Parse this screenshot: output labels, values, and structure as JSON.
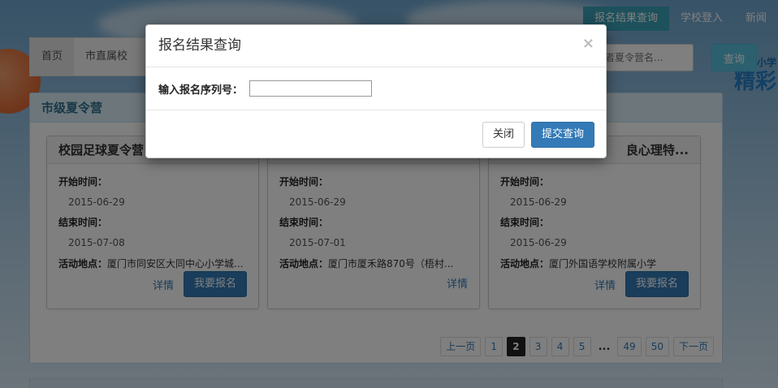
{
  "topnav": {
    "items": [
      {
        "label": "报名结果查询",
        "active": true
      },
      {
        "label": "学校登入",
        "active": false
      },
      {
        "label": "新闻",
        "active": false
      }
    ]
  },
  "brand": {
    "line1": "厦门中小学",
    "line2": "精彩"
  },
  "tabs": [
    {
      "label": "首页",
      "active": true
    },
    {
      "label": "市直属校",
      "active": false
    }
  ],
  "search": {
    "placeholder": "或者夏令营名...",
    "button_label": "查询"
  },
  "panel": {
    "title": "市级夏令营",
    "cards": [
      {
        "title": "校园足球夏令营",
        "start_label": "开始时间：",
        "start": "2015-06-29",
        "end_label": "结束时间：",
        "end": "2015-07-08",
        "place_label": "活动地点：",
        "place": "厦门市同安区大同中心小学城...",
        "detail_label": "详情",
        "signup_label": "我要报名",
        "has_signup": true
      },
      {
        "title": "",
        "start_label": "开始时间：",
        "start": "2015-06-29",
        "end_label": "结束时间：",
        "end": "2015-07-01",
        "place_label": "活动地点：",
        "place": "厦门市厦禾路870号（梧村...",
        "detail_label": "详情",
        "signup_label": "",
        "has_signup": false
      },
      {
        "title": "良心理特...",
        "start_label": "开始时间：",
        "start": "2015-06-29",
        "end_label": "结束时间：",
        "end": "2015-06-29",
        "place_label": "活动地点：",
        "place": "厦门外国语学校附属小学",
        "detail_label": "详情",
        "signup_label": "我要报名",
        "has_signup": true
      }
    ]
  },
  "pagination": {
    "prev": "上一页",
    "pages": [
      "1",
      "2",
      "3",
      "4",
      "5"
    ],
    "current": "2",
    "ellipsis": "...",
    "tail_pages": [
      "49",
      "50"
    ],
    "next": "下一页"
  },
  "modal": {
    "title": "报名结果查询",
    "close_symbol": "×",
    "field_label": "输入报名序列号：",
    "field_value": "",
    "close_button": "关闭",
    "submit_button": "提交查询"
  }
}
